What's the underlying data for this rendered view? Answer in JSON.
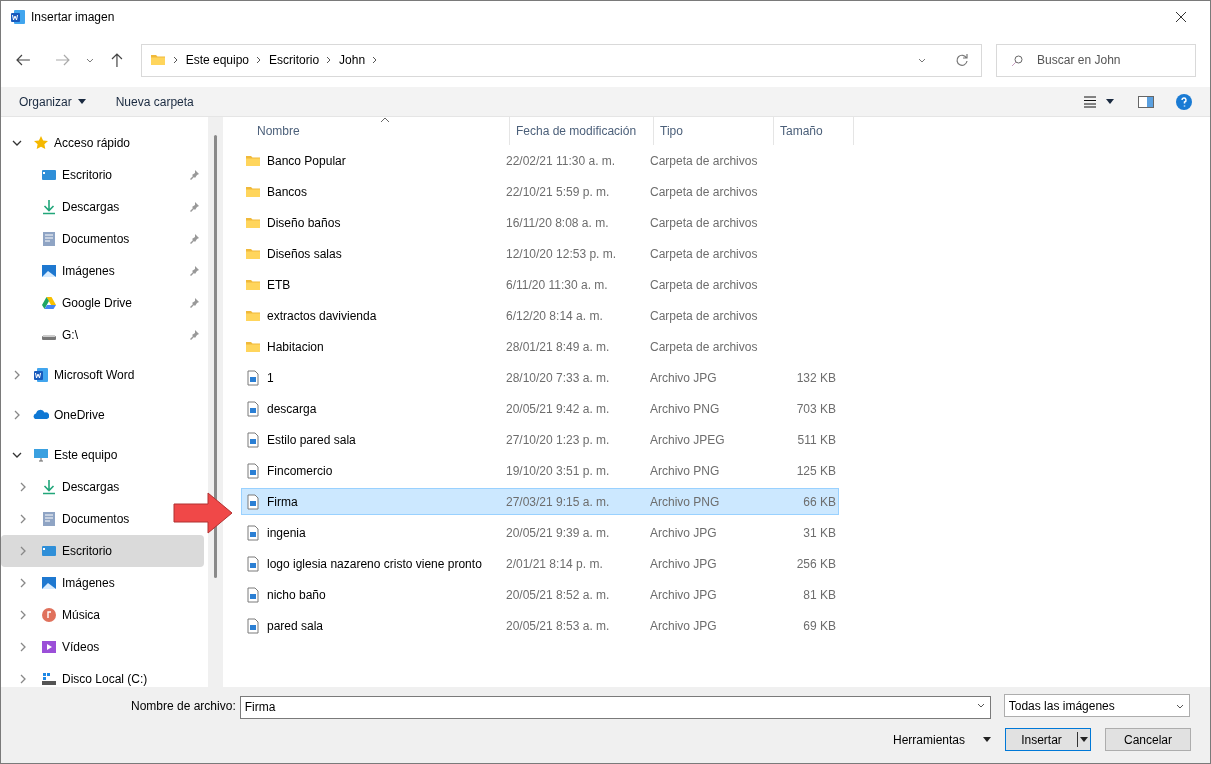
{
  "window": {
    "title": "Insertar imagen"
  },
  "address": {
    "path": [
      "Este equipo",
      "Escritorio",
      "John"
    ]
  },
  "search": {
    "placeholder": "Buscar en John"
  },
  "toolbar": {
    "organize": "Organizar",
    "new_folder": "Nueva carpeta"
  },
  "sidebar": {
    "items": [
      {
        "label": "Acceso rápido",
        "kind": "star",
        "expanded": true,
        "selected": false,
        "children": [
          {
            "label": "Escritorio",
            "kind": "desktop",
            "pinned": true,
            "selected": false
          },
          {
            "label": "Descargas",
            "kind": "download",
            "pinned": true,
            "selected": false
          },
          {
            "label": "Documentos",
            "kind": "documents",
            "pinned": true,
            "selected": false
          },
          {
            "label": "Imágenes",
            "kind": "pictures",
            "pinned": true,
            "selected": false
          },
          {
            "label": "Google Drive",
            "kind": "gdrive",
            "pinned": true,
            "selected": false
          },
          {
            "label": "G:\\",
            "kind": "drive",
            "pinned": true,
            "selected": false
          }
        ]
      },
      {
        "label": "Microsoft Word",
        "kind": "word",
        "expanded": false,
        "selected": false
      },
      {
        "label": "OneDrive",
        "kind": "onedrive",
        "expanded": false,
        "selected": false
      },
      {
        "label": "Este equipo",
        "kind": "pc",
        "expanded": true,
        "selected": false,
        "children": [
          {
            "label": "Descargas",
            "kind": "download",
            "expanded": false,
            "selected": false
          },
          {
            "label": "Documentos",
            "kind": "documents",
            "expanded": false,
            "selected": false
          },
          {
            "label": "Escritorio",
            "kind": "desktop",
            "expanded": false,
            "selected": true
          },
          {
            "label": "Imágenes",
            "kind": "pictures",
            "expanded": false,
            "selected": false
          },
          {
            "label": "Música",
            "kind": "music",
            "expanded": false,
            "selected": false
          },
          {
            "label": "Vídeos",
            "kind": "video",
            "expanded": false,
            "selected": false
          },
          {
            "label": "Disco Local (C:)",
            "kind": "disk",
            "expanded": false,
            "selected": false
          }
        ]
      }
    ]
  },
  "table": {
    "columns": [
      "Nombre",
      "Fecha de modificación",
      "Tipo",
      "Tamaño"
    ],
    "rows": [
      {
        "name": "Banco Popular",
        "date": "22/02/21 11:30 a. m.",
        "type": "Carpeta de archivos",
        "kind": "folder",
        "selected": false
      },
      {
        "name": "Bancos",
        "date": "22/10/21 5:59 p. m.",
        "type": "Carpeta de archivos",
        "kind": "folder",
        "selected": false
      },
      {
        "name": "Diseño baños",
        "date": "16/11/20 8:08 a. m.",
        "type": "Carpeta de archivos",
        "kind": "folder",
        "selected": false
      },
      {
        "name": "Diseños salas",
        "date": "12/10/20 12:53 p. m.",
        "type": "Carpeta de archivos",
        "kind": "folder",
        "selected": false
      },
      {
        "name": "ETB",
        "date": "6/11/20 11:30 a. m.",
        "type": "Carpeta de archivos",
        "kind": "folder",
        "selected": false
      },
      {
        "name": "extractos davivienda",
        "date": "6/12/20 8:14 a. m.",
        "type": "Carpeta de archivos",
        "kind": "folder",
        "selected": false
      },
      {
        "name": "Habitacion",
        "date": "28/01/21 8:49 a. m.",
        "type": "Carpeta de archivos",
        "kind": "folder",
        "selected": false
      },
      {
        "name": "1",
        "date": "28/10/20 7:33 a. m.",
        "type": "Archivo JPG",
        "size": "132 KB",
        "kind": "image",
        "selected": false
      },
      {
        "name": "descarga",
        "date": "20/05/21 9:42 a. m.",
        "type": "Archivo PNG",
        "size": "703 KB",
        "kind": "image",
        "selected": false
      },
      {
        "name": "Estilo pared sala",
        "date": "27/10/20 1:23 p. m.",
        "type": "Archivo JPEG",
        "size": "511 KB",
        "kind": "image",
        "selected": false
      },
      {
        "name": "Fincomercio",
        "date": "19/10/20 3:51 p. m.",
        "type": "Archivo PNG",
        "size": "125 KB",
        "kind": "image",
        "selected": false
      },
      {
        "name": "Firma",
        "date": "27/03/21 9:15 a. m.",
        "type": "Archivo PNG",
        "size": "66 KB",
        "kind": "image",
        "selected": true
      },
      {
        "name": "ingenia",
        "date": "20/05/21 9:39 a. m.",
        "type": "Archivo JPG",
        "size": "31 KB",
        "kind": "image",
        "selected": false
      },
      {
        "name": "logo iglesia nazareno cristo viene pronto",
        "date": "2/01/21 8:14 p. m.",
        "type": "Archivo JPG",
        "size": "256 KB",
        "kind": "image",
        "selected": false
      },
      {
        "name": "nicho baño",
        "date": "20/05/21 8:52 a. m.",
        "type": "Archivo JPG",
        "size": "81 KB",
        "kind": "image",
        "selected": false
      },
      {
        "name": "pared sala",
        "date": "20/05/21 8:53 a. m.",
        "type": "Archivo JPG",
        "size": "69 KB",
        "kind": "image",
        "selected": false
      }
    ]
  },
  "footer": {
    "filename_label": "Nombre de archivo:",
    "filename": "Firma",
    "filter": "Todas las imágenes",
    "tools": "Herramientas",
    "insert": "Insertar",
    "cancel": "Cancelar"
  }
}
